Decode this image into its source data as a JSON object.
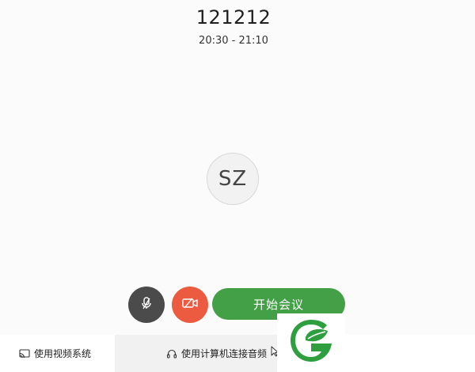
{
  "meeting": {
    "title": "121212",
    "time": "20:30 - 21:10"
  },
  "participant": {
    "initials": "SZ"
  },
  "controls": {
    "mic_icon": "microphone-muted-icon",
    "camera_icon": "camera-off-icon",
    "start_label": "开始会议"
  },
  "footer": {
    "video_system_label": "使用视频系统",
    "computer_audio_label": "使用计算机连接音频",
    "video_system_icon": "cast-icon",
    "computer_audio_icon": "headset-icon"
  },
  "colors": {
    "mic_button": "#4b4b4b",
    "camera_button": "#ec5a3f",
    "start_button": "#43a047",
    "logo_green": "#2e9e3f"
  },
  "logo": {
    "icon": "leaf-g-logo"
  }
}
